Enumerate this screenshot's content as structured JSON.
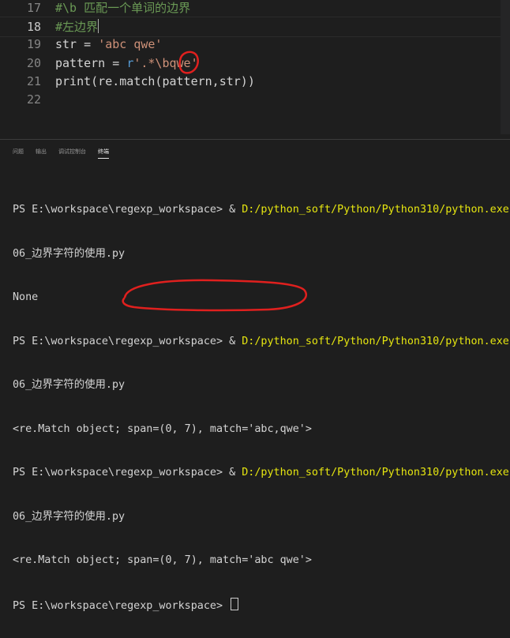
{
  "editor": {
    "lines": [
      {
        "num": "17",
        "segments": [
          {
            "text": "#\\b 匹配一个单词的边界",
            "cls": "comment"
          }
        ]
      },
      {
        "num": "18",
        "current": true,
        "segments": [
          {
            "text": "#左边界",
            "cls": "comment"
          }
        ]
      },
      {
        "num": "19",
        "segments": [
          {
            "text": "str = ",
            "cls": "plain"
          },
          {
            "text": "'abc qwe'",
            "cls": "str"
          }
        ]
      },
      {
        "num": "20",
        "segments": [
          {
            "text": "pattern = ",
            "cls": "plain"
          },
          {
            "text": "r",
            "cls": "kw"
          },
          {
            "text": "'.*\\bqwe'",
            "cls": "str"
          }
        ]
      },
      {
        "num": "21",
        "segments": [
          {
            "text": "print(re.match(pattern,str))",
            "cls": "plain"
          }
        ]
      },
      {
        "num": "22",
        "segments": []
      }
    ]
  },
  "panel": {
    "tabs": [
      {
        "label": "问题",
        "active": false
      },
      {
        "label": "输出",
        "active": false
      },
      {
        "label": "调试控制台",
        "active": false
      },
      {
        "label": "终端",
        "active": true
      }
    ],
    "terminal": {
      "prompt": "PS E:\\workspace\\regexp_workspace> ",
      "command_prefix": "& ",
      "python_path": "D:/python_soft/Python/Python310/python.exe",
      "script_name": "06_边界字符的使用.py",
      "outputs": [
        "None",
        "<re.Match object; span=(0, 7), match='abc,qwe'>",
        "<re.Match object; span=(0, 7), match='abc qwe'>"
      ]
    }
  },
  "colors": {
    "background": "#1e1e1e",
    "comment": "#6a9955",
    "string": "#ce9178",
    "keyword": "#569cd6",
    "path_highlight": "#e5e510",
    "annotation": "#e0201e"
  }
}
